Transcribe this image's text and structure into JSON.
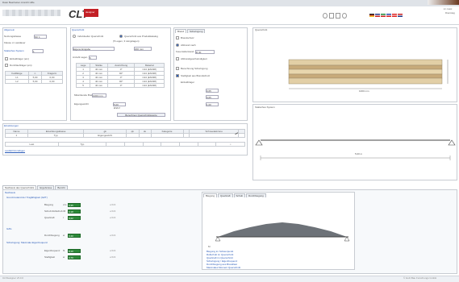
{
  "titlebar": {
    "menu_text": "Datei   Bearbeiten   Ansicht   Hilfe"
  },
  "header": {
    "logo": "CLT",
    "logo_sub": "designer",
    "user_line1": "k.t.rossi",
    "user_line2": "Dienstag",
    "flags": [
      {
        "name": "germany",
        "c1": "#222",
        "c2": "#d33",
        "c3": "#f0c020"
      },
      {
        "name": "uk",
        "c1": "#223a8a",
        "c2": "#fff",
        "c3": "#c22"
      },
      {
        "name": "italy",
        "c1": "#1a8a3a",
        "c2": "#fff",
        "c3": "#c22"
      },
      {
        "name": "france",
        "c1": "#234ab0",
        "c2": "#fff",
        "c3": "#d22"
      },
      {
        "name": "austria",
        "c1": "#d22",
        "c2": "#fff",
        "c3": "#d22"
      },
      {
        "name": "usa",
        "c1": "#c22",
        "c2": "#fff",
        "c3": "#223a8a"
      }
    ]
  },
  "left_panel": {
    "title": "Allgemein",
    "fields": [
      {
        "label": "Nutzungsklasse",
        "value": "NK 1"
      },
      {
        "label": "Klasse d. Lastdauer",
        "value": ""
      },
      {
        "label": "Statisches System",
        "value": "1"
      }
    ],
    "checkboxes": [
      "Einfeldträger (ein)",
      "Durchlaufträger (ein)"
    ],
    "table_headers": [
      "Feldlänge",
      "n",
      "Kragarm"
    ],
    "table_rows": [
      [
        "L1",
        "5,00",
        "0,00"
      ],
      [
        "L2",
        "5,00",
        "0,00"
      ]
    ]
  },
  "mid_panel": {
    "title": "Querschnitt",
    "radio1": "Individueller Querschnitt",
    "radio2": "Querschnitt aus Produktkatalog",
    "sub": "(5 Lagen, 3 Längslagen)",
    "producer_label": "Eigene Einstellung",
    "producer_value": "Eigene Eingabe",
    "thickness_value": "200 mm",
    "layers_label": "Anzahl Lagen",
    "layers_value": "5",
    "table_headers": [
      "Lage",
      "Stärke",
      "Ausrichtung",
      "Material"
    ],
    "table_rows": [
      [
        "1",
        "40 mm",
        "0°",
        "C24 (EN338)"
      ],
      [
        "2",
        "40 mm",
        "90°",
        "C24 (EN338)"
      ],
      [
        "3",
        "40 mm",
        "0°",
        "C24 (EN338)"
      ],
      [
        "4",
        "40 mm",
        "90°",
        "C24 (EN338)"
      ],
      [
        "5",
        "40 mm",
        "0°",
        "C24 (EN338)"
      ]
    ],
    "width_label": "Mitwirkende Breite",
    "width_value": "1000 mm",
    "weight_label": "Eigengewicht",
    "weight_value": "5,00 kN/m³",
    "button_label": "Berechnen Querschnittswerte"
  },
  "right_opts": {
    "tabs": [
      "Brand",
      "Schwingung"
    ],
    "items": [
      "Brandschutz",
      "Abbrand nach",
      "Eurocode",
      "Abbrandgeschwindigkeit"
    ],
    "chk_items": [
      "Berechnung Schwingung",
      "Steifigkeit aus Brandschutz",
      "Einfeldträger"
    ],
    "duration_label": "Feuerwiderstand",
    "duration_value": "R 30",
    "inputs": [
      "0,65",
      "0,65",
      "1,00"
    ]
  },
  "loads_panel": {
    "title": "Einwirkungen",
    "headers": [
      "Name",
      "Einwirkungsklasse",
      "gk",
      "qk",
      "sk",
      "Kategorie",
      "",
      "Schneelastzone",
      ""
    ],
    "row1": [
      "1",
      "Typ",
      "Eigengewicht",
      "",
      "",
      "",
      "",
      "",
      ""
    ],
    "add_label": "Lastfall hinzufügen",
    "row2": [
      "Last",
      "Typ",
      "",
      "",
      "",
      "",
      "",
      "",
      ""
    ]
  },
  "view_top": {
    "label": "Querschnitt",
    "dim": "1000 mm"
  },
  "view_bottom": {
    "label": "Statisches System",
    "dim": "5,00 m"
  },
  "bottom_tabs": [
    "Nachweis des Querschnitts",
    "Ergebnisse",
    "Bericht"
  ],
  "results": {
    "title": "Nachweis",
    "section1": "Grenzzustand der Tragfähigkeit (GZT)",
    "rows": [
      {
        "label": "Biegung",
        "sym": "σm",
        "val": "0,35",
        "ok": "erfüllt"
      },
      {
        "label": "Schub Rollschub",
        "sym": "τR",
        "val": "0,18",
        "ok": "erfüllt"
      },
      {
        "label": "Querkraft",
        "sym": "τ",
        "val": "0,22",
        "ok": "erfüllt"
      }
    ],
    "section2": "GZG",
    "deflection": {
      "label": "Durchbiegung",
      "sym": "w",
      "val": "0,40",
      "ok": "erfüllt"
    },
    "section3": "Schwingung: Maximale Eigenfrequenz",
    "rows2": [
      {
        "label": "Eigenfrequenz",
        "sym": "f1",
        "val": "8,10",
        "ok": "erfüllt"
      },
      {
        "label": "Steifigkeit",
        "sym": "w",
        "val": "0,70",
        "ok": "erfüllt"
      }
    ]
  },
  "diagram_tabs": [
    "Biegung",
    "Querkraft",
    "Schub",
    "Durchbiegung"
  ],
  "diagram": {
    "legend": [
      "Biegung im Schwerpunkt",
      "Rollschub im Querschnitt",
      "Querkraft im Querschnitt",
      "Schwingung / Eigenfrequenz",
      "Durchbiegung aus Brandlast",
      "Maximales Moment Querschnitt"
    ],
    "moment_label": "M"
  },
  "status": {
    "left": "CLTdesigner v5.0.0",
    "right": "© Holz.Bau Forschungs GmbH"
  }
}
